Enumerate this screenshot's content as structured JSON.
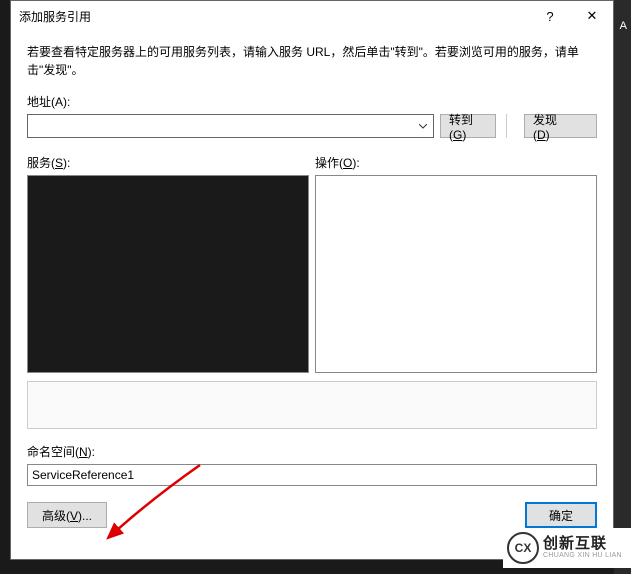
{
  "dialog": {
    "title": "添加服务引用",
    "help": "?",
    "close": "✕",
    "instructions": "若要查看特定服务器上的可用服务列表，请输入服务 URL，然后单击\"转到\"。若要浏览可用的服务，请单击\"发现\"。",
    "address_label": "地址(A):",
    "address_value": "",
    "go_btn": "转到(G)",
    "discover_btn": "发现(D)",
    "services_label": "服务(S):",
    "operations_label": "操作(O):",
    "namespace_label": "命名空间(N):",
    "namespace_value": "ServiceReference1",
    "advanced_btn": "高级(V)...",
    "ok_btn": "确定"
  },
  "logo": {
    "cn": "创新互联",
    "en": "CHUANG XIN HU LIAN",
    "mark": "CX"
  },
  "side": {
    "a": "A"
  }
}
